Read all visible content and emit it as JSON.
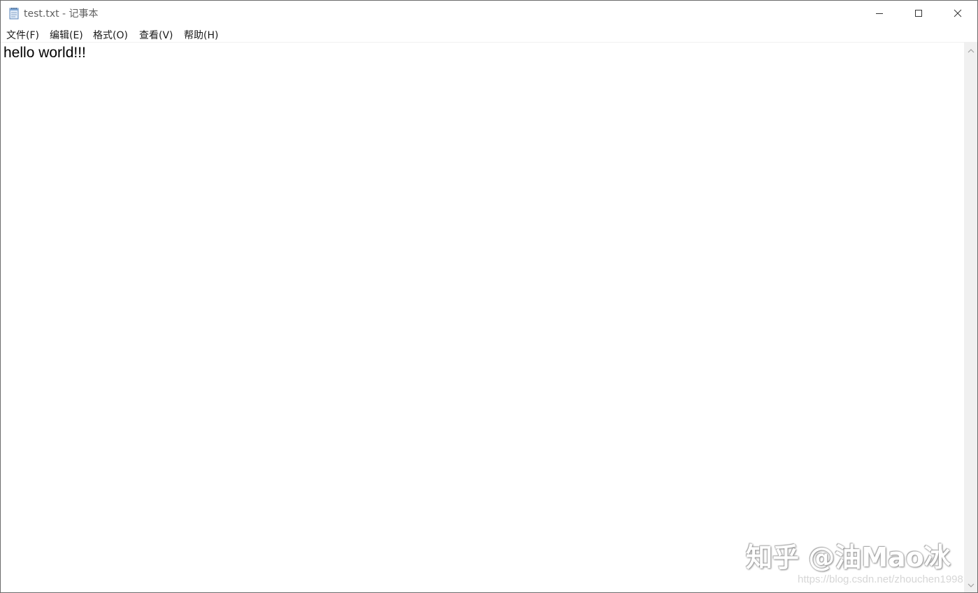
{
  "window": {
    "title": "test.txt - 记事本",
    "icon": "notepad-icon"
  },
  "controls": {
    "minimize_icon": "minimize-icon",
    "maximize_icon": "maximize-icon",
    "close_icon": "close-icon"
  },
  "menu": {
    "items": [
      {
        "label": "文件(F)"
      },
      {
        "label": "编辑(E)"
      },
      {
        "label": "格式(O)"
      },
      {
        "label": "查看(V)"
      },
      {
        "label": "帮助(H)"
      }
    ]
  },
  "editor": {
    "content": "hello world!!!"
  },
  "scrollbar": {
    "up_icon": "scroll-up-icon",
    "down_icon": "scroll-down-icon"
  },
  "watermarks": {
    "zhihu": "知乎 @油Mao冰",
    "url": "https://blog.csdn.net/zhouchen1998"
  }
}
